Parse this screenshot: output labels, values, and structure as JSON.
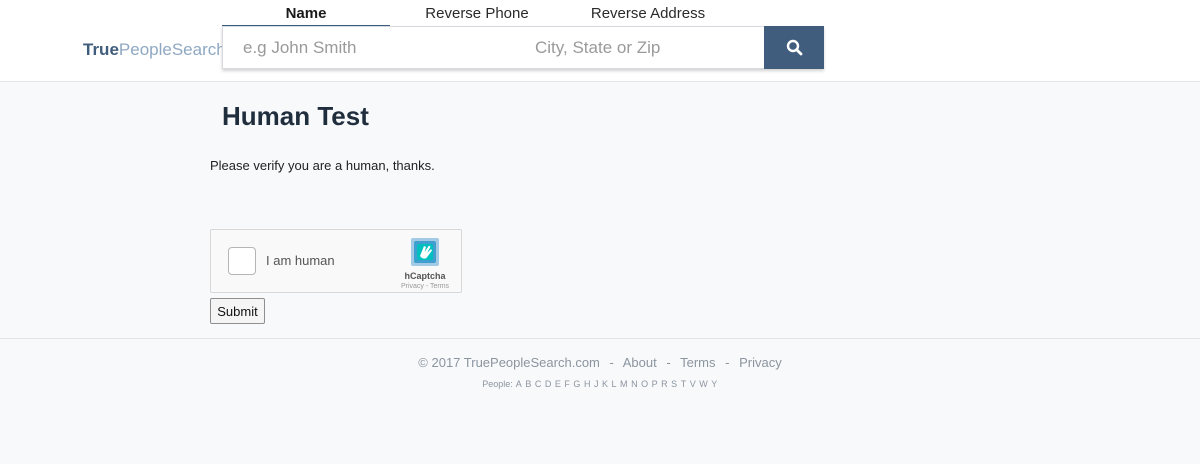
{
  "header": {
    "logo_true": "True",
    "logo_rest": "PeopleSearch",
    "tabs": [
      {
        "label": "Name"
      },
      {
        "label": "Reverse Phone"
      },
      {
        "label": "Reverse Address"
      }
    ],
    "search": {
      "name_placeholder": "e.g John Smith",
      "location_placeholder": "City, State or Zip",
      "button_icon": "search-icon"
    },
    "accent_color": "#415d7e"
  },
  "main": {
    "title": "Human Test",
    "message": "Please verify you are a human, thanks.",
    "captcha": {
      "label": "I am human",
      "brand": "hCaptcha",
      "privacy": "Privacy",
      "separator": " - ",
      "terms": "Terms"
    },
    "submit_label": "Submit"
  },
  "footer": {
    "copyright": "© 2017 TruePeopleSearch.com",
    "links": [
      "About",
      "Terms",
      "Privacy"
    ],
    "separator": "-",
    "people_label": "People:",
    "letters": [
      "A",
      "B",
      "C",
      "D",
      "E",
      "F",
      "G",
      "H",
      "J",
      "K",
      "L",
      "M",
      "N",
      "O",
      "P",
      "R",
      "S",
      "T",
      "V",
      "W",
      "Y"
    ]
  }
}
